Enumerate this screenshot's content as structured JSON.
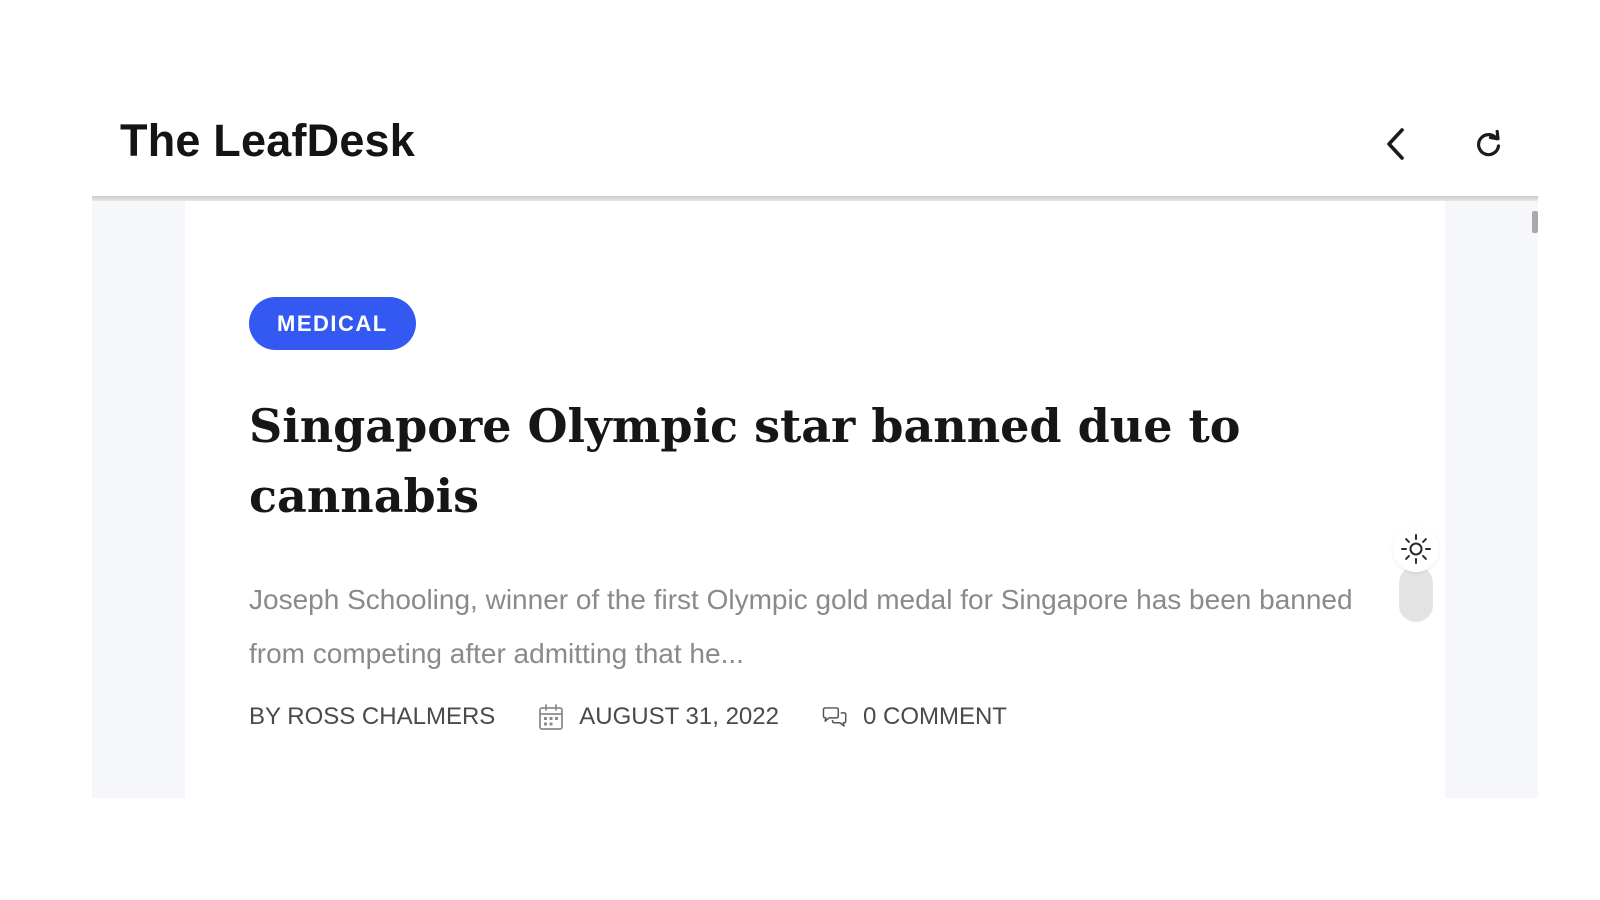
{
  "app": {
    "title": "The LeafDesk"
  },
  "toolbar": {
    "back_icon": "chevron-left-icon",
    "reload_icon": "reload-icon"
  },
  "article": {
    "category": "MEDICAL",
    "headline": "Singapore Olympic star banned due to cannabis",
    "excerpt": "Joseph Schooling, winner of the first Olympic gold medal for Singapore has been banned from competing after admitting that he...",
    "author": "BY ROSS CHALMERS",
    "date": "AUGUST 31, 2022",
    "comments": "0 COMMENT"
  },
  "theme_toggle": {
    "icon": "sun-icon"
  },
  "colors": {
    "accent": "#3459f2",
    "headline": "#161616",
    "excerpt": "#8a8a8a",
    "meta": "#4a4a4a",
    "page_background": "#f6f7fb"
  }
}
